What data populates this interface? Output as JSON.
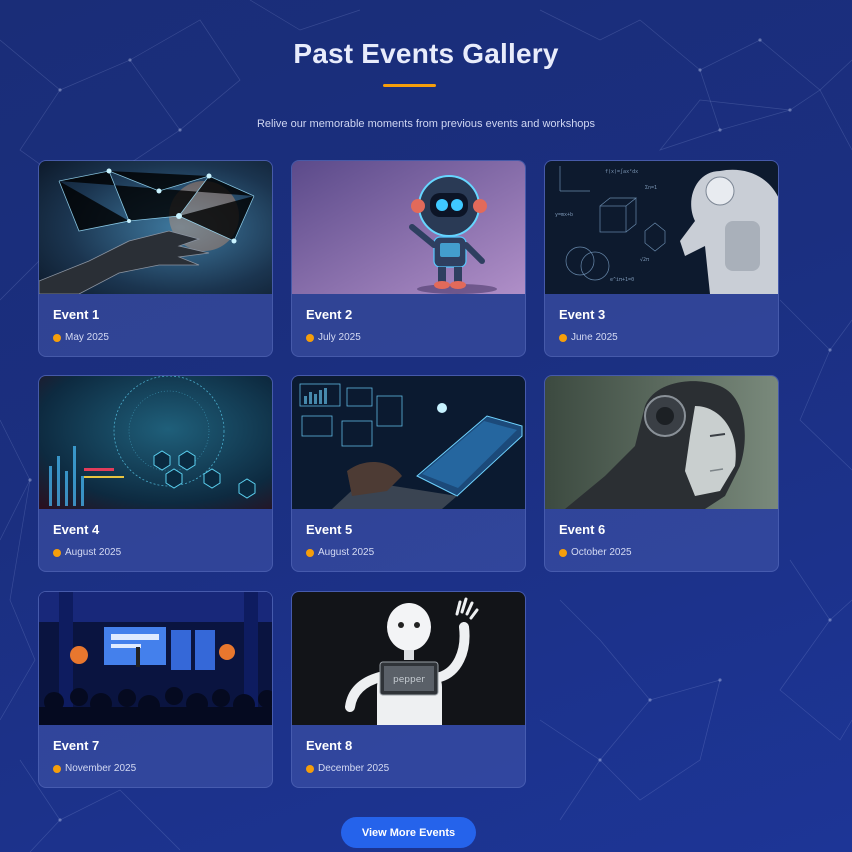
{
  "header": {
    "title": "Past Events Gallery",
    "subtitle": "Relive our memorable moments from previous events and workshops",
    "underline_color": "#f59e0b"
  },
  "events": [
    {
      "title": "Event 1",
      "date": "May 2025",
      "image": "robot-hand-network"
    },
    {
      "title": "Event 2",
      "date": "July 2025",
      "image": "cute-robot"
    },
    {
      "title": "Event 3",
      "date": "June 2025",
      "image": "android-thinking-formulas"
    },
    {
      "title": "Event 4",
      "date": "August 2025",
      "image": "digital-globe-hexagons"
    },
    {
      "title": "Event 5",
      "date": "August 2025",
      "image": "laptop-holograms"
    },
    {
      "title": "Event 6",
      "date": "October 2025",
      "image": "cyborg-face"
    },
    {
      "title": "Event 7",
      "date": "November 2025",
      "image": "conference-stage"
    },
    {
      "title": "Event 8",
      "date": "December 2025",
      "image": "pepper-robot-waving"
    }
  ],
  "actions": {
    "view_more_label": "View More Events"
  },
  "colors": {
    "accent": "#f59e0b",
    "button": "#2563eb",
    "background": "#1b2f80"
  }
}
